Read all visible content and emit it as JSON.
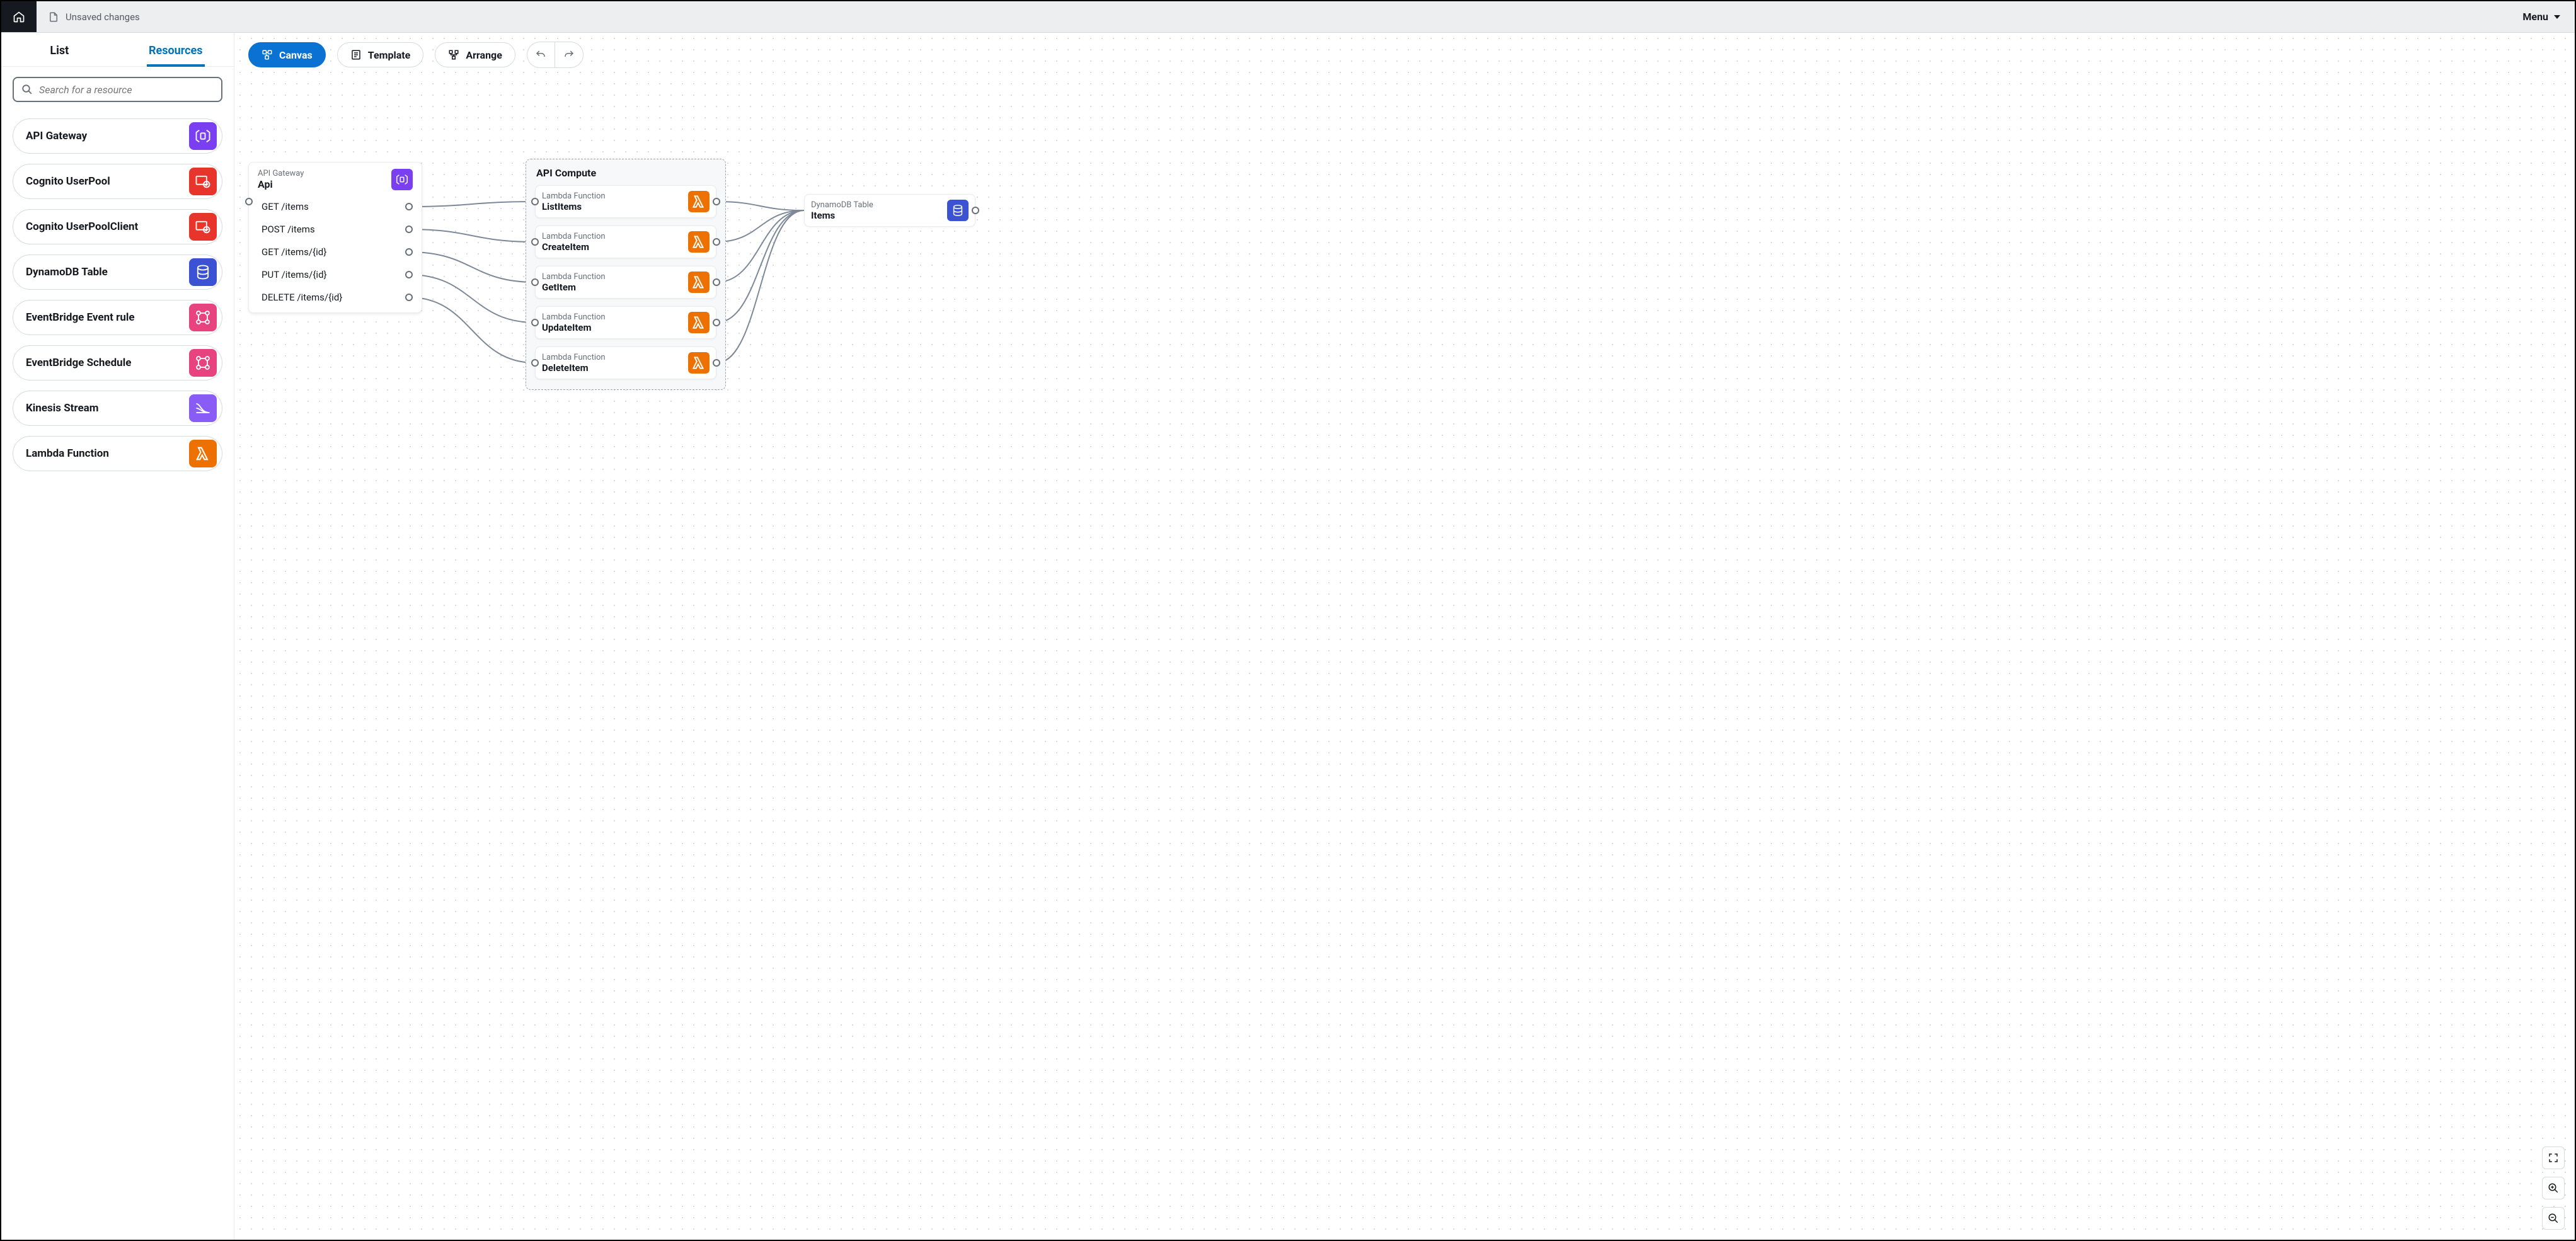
{
  "topbar": {
    "unsaved": "Unsaved changes",
    "menu": "Menu"
  },
  "sidebar": {
    "tabs": {
      "list": "List",
      "resources": "Resources"
    },
    "search_placeholder": "Search for a resource",
    "items": [
      {
        "label": "API Gateway",
        "color": "c-purple",
        "icon": "apigw"
      },
      {
        "label": "Cognito UserPool",
        "color": "c-red",
        "icon": "cognito"
      },
      {
        "label": "Cognito UserPoolClient",
        "color": "c-red",
        "icon": "cognito"
      },
      {
        "label": "DynamoDB Table",
        "color": "c-blue",
        "icon": "dynamo"
      },
      {
        "label": "EventBridge Event rule",
        "color": "c-pink",
        "icon": "eventbridge"
      },
      {
        "label": "EventBridge Schedule",
        "color": "c-pink",
        "icon": "eventbridge"
      },
      {
        "label": "Kinesis Stream",
        "color": "c-lpurple",
        "icon": "kinesis"
      },
      {
        "label": "Lambda Function",
        "color": "c-orange",
        "icon": "lambda"
      }
    ]
  },
  "toolbar": {
    "canvas": "Canvas",
    "template": "Template",
    "arrange": "Arrange"
  },
  "canvas": {
    "api": {
      "type": "API Gateway",
      "name": "Api",
      "routes": [
        "GET /items",
        "POST /items",
        "GET /items/{id}",
        "PUT /items/{id}",
        "DELETE /items/{id}"
      ]
    },
    "group": {
      "title": "API Compute",
      "lambdas": [
        {
          "type": "Lambda Function",
          "name": "ListItems"
        },
        {
          "type": "Lambda Function",
          "name": "CreateItem"
        },
        {
          "type": "Lambda Function",
          "name": "GetItem"
        },
        {
          "type": "Lambda Function",
          "name": "UpdateItem"
        },
        {
          "type": "Lambda Function",
          "name": "DeleteItem"
        }
      ]
    },
    "dynamo": {
      "type": "DynamoDB Table",
      "name": "Items"
    }
  }
}
